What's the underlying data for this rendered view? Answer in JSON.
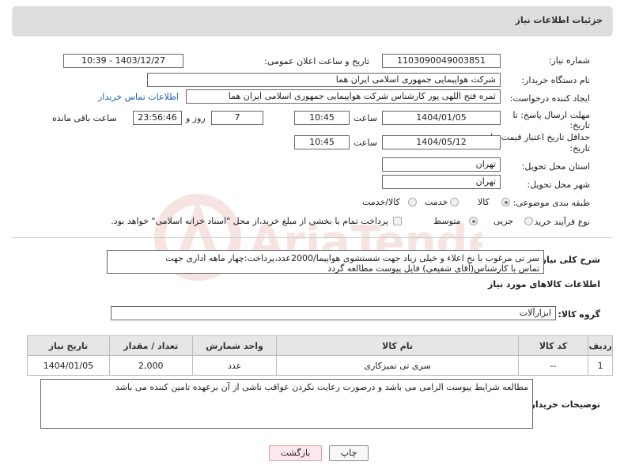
{
  "header": {
    "title": "جزئیات اطلاعات نیاز"
  },
  "form": {
    "need_number": {
      "label": "شماره نیاز:",
      "value": "1103090049003851"
    },
    "announce_datetime": {
      "label": "تاریخ و ساعت اعلان عمومی:",
      "value": "1403/12/27 - 10:39"
    },
    "buyer_org": {
      "label": "نام دستگاه خریدار:",
      "value": "شرکت هواپیمایی جمهوری اسلامی ایران هما"
    },
    "requester": {
      "label": "ایجاد کننده درخواست:",
      "value": "ثمره فتح اللهی پور کارشناس شرکت هواپیمایی جمهوری اسلامی ایران هما",
      "contact_link": "اطلاعات تماس خریدار"
    },
    "reply_deadline": {
      "label_line1": "مهلت ارسال پاسخ: تا",
      "label_line2": "تاریخ:",
      "date": "1404/01/05",
      "time_label": "ساعت",
      "time": "10:45",
      "days": "7",
      "days_label": "روز و",
      "remaining": "23:56:46",
      "remaining_label": "ساعت باقی مانده"
    },
    "price_validity": {
      "label_line1": "حداقل تاریخ اعتبار قیمت: تا",
      "label_line2": "تاریخ:",
      "date": "1404/05/12",
      "time_label": "ساعت",
      "time": "10:45"
    },
    "province": {
      "label": "استان محل تحویل:",
      "value": "تهران"
    },
    "city": {
      "label": "شهر محل تحویل:",
      "value": "تهران"
    },
    "category": {
      "label": "طبقه بندی موضوعی:",
      "options": [
        "کالا",
        "خدمت",
        "کالا/خدمت"
      ],
      "selected": "کالا"
    },
    "purchase_type": {
      "label": "نوع فرآیند خرید :",
      "options": [
        "جزیی",
        "متوسط"
      ],
      "selected": "متوسط",
      "payment_note": "پرداخت تمام یا بخشی از مبلغ خرید،از محل \"اسناد خزانه اسلامی\" خواهد بود."
    }
  },
  "description": {
    "label": "شرح کلی نیاز:",
    "line1": "سر تی مرغوب با نخ اعلاء و خیلی زیاد جهت شستشوی هواپیما/2000عدد،پرداخت:چهار ماهه اداری جهت",
    "line2": "تماس با کارشناس(آقای شفیعی) فایل پیوست مطالعه گردد"
  },
  "goods_section": {
    "title": "اطلاعات کالاهای مورد نیاز",
    "group_label": "گروه کالا:",
    "group_value": "ابزارآلات"
  },
  "table": {
    "headers": [
      "ردیف",
      "کد کالا",
      "نام کالا",
      "واحد شمارش",
      "تعداد / مقدار",
      "تاریخ نیاز"
    ],
    "rows": [
      [
        "1",
        "--",
        "سری تی تمیزکاری",
        "عدد",
        "2,000",
        "1404/01/05"
      ]
    ]
  },
  "buyer_notes": {
    "label": "توضیحات خریدار:",
    "text": "مطالعه شرایط پیوست الزامی می باشد و درصورت رعایت نکردن عواقب ناشی از آن برعهده تامین کننده می باشد"
  },
  "buttons": {
    "print": "چاپ",
    "back": "بازگشت"
  },
  "watermark": {
    "text": "AriaTender.net",
    "color": "#c0392b"
  }
}
